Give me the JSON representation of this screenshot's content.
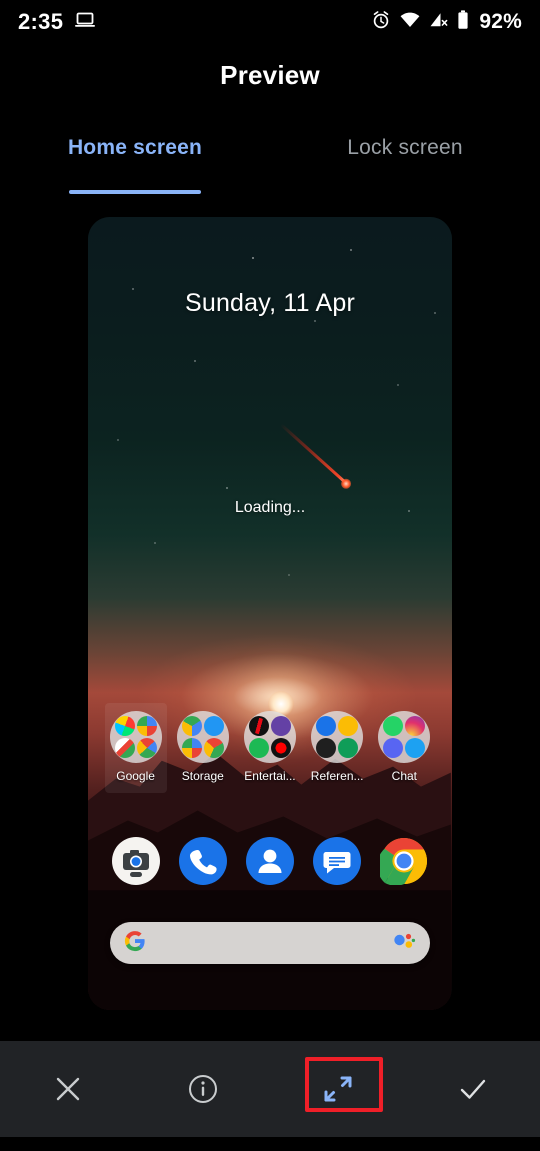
{
  "statusbar": {
    "time": "2:35",
    "battery_percent": "92%",
    "icons": [
      "laptop-cast-icon",
      "alarm-icon",
      "wifi-icon",
      "mobile-data-off-icon",
      "battery-icon"
    ]
  },
  "header": {
    "title": "Preview"
  },
  "tabs": [
    {
      "label": "Home screen",
      "active": true
    },
    {
      "label": "Lock screen",
      "active": false
    }
  ],
  "preview": {
    "date": "Sunday, 11 Apr",
    "status": "Loading...",
    "wallpaper_name": "night-sky-sunset-mountains",
    "folders": [
      {
        "label": "Google",
        "selected": true,
        "apps": [
          "play-store",
          "google-search",
          "gmail",
          "maps"
        ]
      },
      {
        "label": "Storage",
        "selected": false,
        "apps": [
          "drive",
          "files",
          "photos",
          "one-drive"
        ]
      },
      {
        "label": "Entertai...",
        "selected": false,
        "apps": [
          "netflix",
          "twitch",
          "spotify",
          "youtube"
        ]
      },
      {
        "label": "Referen...",
        "selected": false,
        "apps": [
          "classroom",
          "keep",
          "podcasts",
          "sheets"
        ]
      },
      {
        "label": "Chat",
        "selected": false,
        "apps": [
          "whatsapp",
          "instagram",
          "discord",
          "twitter"
        ]
      }
    ],
    "dock": [
      {
        "name": "Camera Go",
        "icon": "camera-icon"
      },
      {
        "name": "Phone",
        "icon": "phone-icon"
      },
      {
        "name": "Contacts",
        "icon": "contacts-icon"
      },
      {
        "name": "Messages",
        "icon": "messages-icon"
      },
      {
        "name": "Chrome",
        "icon": "chrome-icon"
      }
    ],
    "search": {
      "left_icon": "google-g-icon",
      "right_icon": "assistant-icon",
      "placeholder": ""
    }
  },
  "actionbar": {
    "buttons": [
      {
        "name": "close",
        "icon": "close-x-icon",
        "label": "",
        "highlighted": false
      },
      {
        "name": "info",
        "icon": "info-circle-icon",
        "label": "",
        "highlighted": false
      },
      {
        "name": "expand",
        "icon": "expand-arrows-icon",
        "label": "",
        "highlighted": true
      },
      {
        "name": "confirm",
        "icon": "check-icon",
        "label": "",
        "highlighted": false
      }
    ],
    "highlight_color": "#f01f28"
  },
  "colors": {
    "accent": "#8ab4f8",
    "inactive_tab": "#9aa0a6",
    "actionbar_bg": "#212326",
    "background": "#000000"
  }
}
